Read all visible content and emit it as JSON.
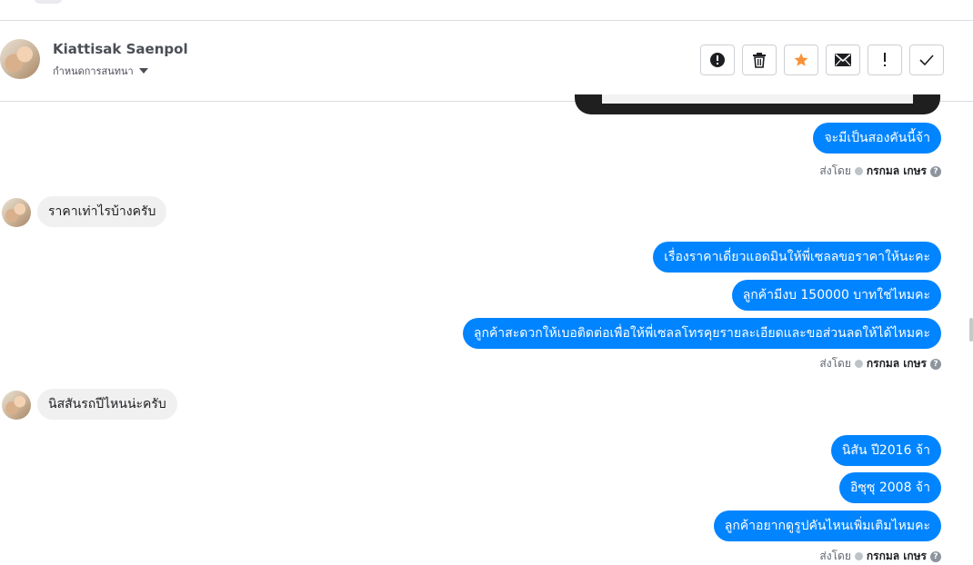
{
  "header": {
    "contact_name": "Kiattisak Saenpol",
    "conversation_settings": "กำหนดการสนทนา",
    "actions": [
      {
        "name": "alert-button",
        "icon": "exclamation-circle-icon"
      },
      {
        "name": "delete-button",
        "icon": "trash-icon"
      },
      {
        "name": "star-button",
        "icon": "star-icon",
        "color": "#f7923b"
      },
      {
        "name": "mail-button",
        "icon": "envelope-icon"
      },
      {
        "name": "mark-important-button",
        "icon": "exclamation-icon"
      },
      {
        "name": "done-button",
        "icon": "check-icon"
      }
    ]
  },
  "messages": {
    "m1": "จะมีเป็นสองคันนี้จ้า",
    "sent1": {
      "prefix": "ส่งโดย",
      "agent": "กรกมล เกษร"
    },
    "m2": "ราคาเท่าไรบ้างครับ",
    "m3": "เรื่องราคาเดี่ยวแอดมินให้พี่เซลลขอราคาให้นะคะ",
    "m4": "ลูกค้ามีงบ 150000 บาทใช่ไหมคะ",
    "m5": "ลูกค้าสะดวกให้เบอติดต่อเพื่อให้พี่เซลลโทรคุยรายละเอียดและขอส่วนลดให้ได้ไหมคะ",
    "sent2": {
      "prefix": "ส่งโดย",
      "agent": "กรกมล เกษร"
    },
    "m6": "นิสสันรถปีไหนน่ะครับ",
    "m7": "นิสัน ปี2016 จ้า",
    "m8": "อิซุซุ 2008 จ้า",
    "m9": "ลูกค้าอยากดูรูปคันไหนเพิ่มเติมไหมคะ",
    "sent3": {
      "prefix": "ส่งโดย",
      "agent": "กรกมล เกษร"
    }
  },
  "colors": {
    "outgoing_bubble": "#0084ff",
    "incoming_bubble": "#f1f0f0",
    "star": "#f7923b"
  }
}
